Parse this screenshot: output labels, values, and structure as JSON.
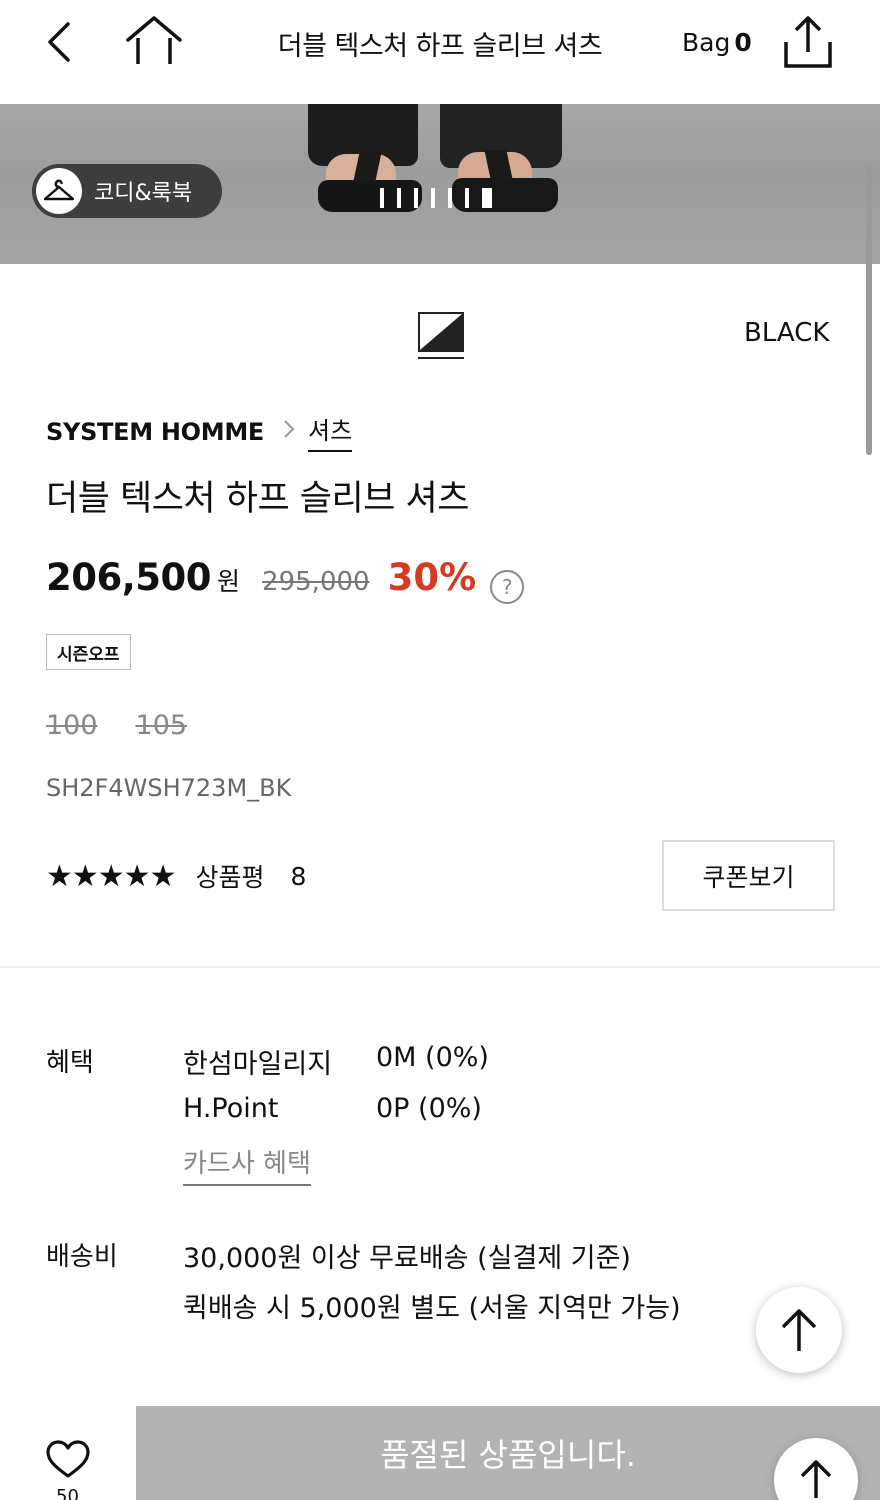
{
  "header": {
    "title": "더블 텍스처 하프 슬리브 셔츠",
    "bag_label": "Bag",
    "bag_count": "0"
  },
  "hero": {
    "codi_label": "코디&룩북",
    "slide_count": 7,
    "active_slide": 7
  },
  "product": {
    "color_name": "BLACK",
    "brand": "SYSTEM HOMME",
    "category": "셔츠",
    "name": "더블 텍스처 하프 슬리브 셔츠",
    "price": "206,500",
    "currency": "원",
    "original_price": "295,000",
    "discount": "30%",
    "tag": "시즌오프",
    "sizes": [
      "100",
      "105"
    ],
    "sku": "SH2F4WSH723M_BK",
    "stars": "★★★★★",
    "rating": 5,
    "review_label": "상품평",
    "review_count": "8",
    "coupon_label": "쿠폰보기"
  },
  "benefits": {
    "label": "혜택",
    "mileage_name": "한섬마일리지",
    "mileage_value": "0M (0%)",
    "hpoint_name": "H.Point",
    "hpoint_value": "0P (0%)",
    "card_link": "카드사 혜택"
  },
  "shipping": {
    "label": "배송비",
    "line1": "30,000원 이상 무료배송 (실결제 기준)",
    "line2": "퀵배송 시 5,000원 별도 (서울 지역만 가능)"
  },
  "bottom": {
    "wish_count": "50",
    "soldout_label": "품절된 상품입니다."
  },
  "colors": {
    "discount": "#d63a22",
    "soldout_bg": "#b3b3b3"
  }
}
